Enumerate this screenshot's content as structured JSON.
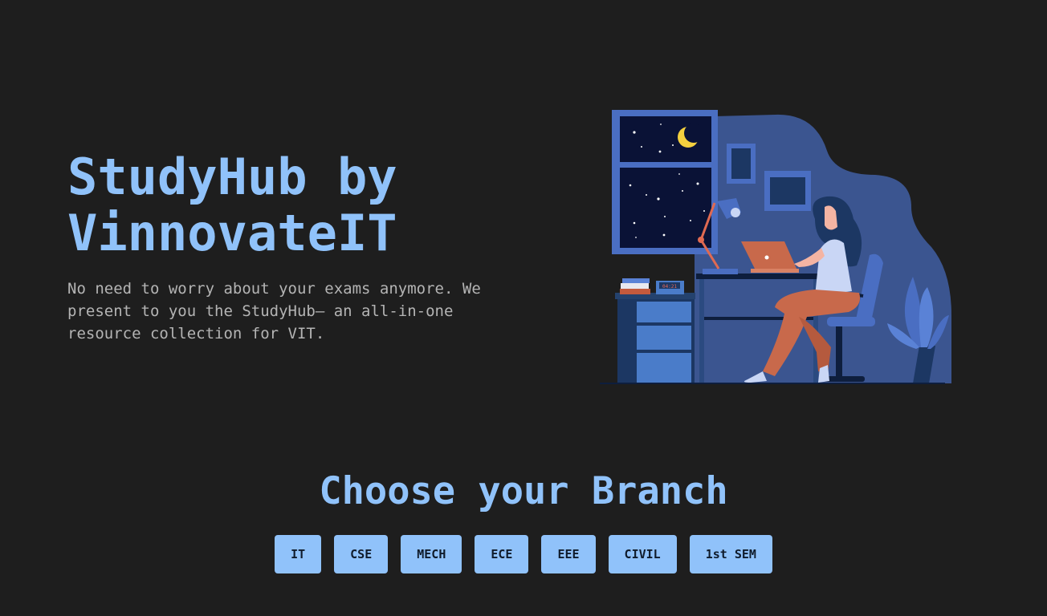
{
  "hero": {
    "title_line1": "StudyHub by",
    "title_line2": "VinnovateIT",
    "description": "No need to worry about your exams anymore. We present to you the StudyHub— an all-in-one resource collection for VIT.",
    "clock_text": "04:21"
  },
  "branches": {
    "heading": "Choose your Branch",
    "items": [
      "IT",
      "CSE",
      "MECH",
      "ECE",
      "EEE",
      "CIVIL",
      "1st SEM"
    ]
  },
  "colors": {
    "background": "#1e1e1e",
    "accent": "#90c2fa",
    "text_muted": "#b4b4b4",
    "button_text": "#0f1b2b"
  }
}
